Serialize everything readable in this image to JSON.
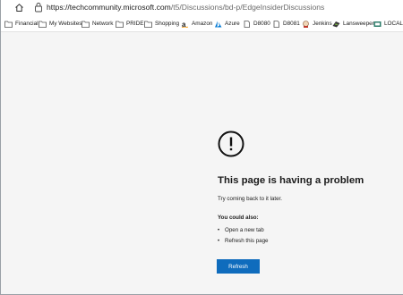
{
  "address_bar": {
    "url_host": "https://techcommunity.microsoft.com",
    "url_path": "/t5/Discussions/bd-p/EdgeInsiderDiscussions"
  },
  "favorites": [
    {
      "label": "Financial",
      "icon": "folder-icon"
    },
    {
      "label": "My Websites",
      "icon": "folder-icon"
    },
    {
      "label": "Network",
      "icon": "folder-icon"
    },
    {
      "label": "PRIDE",
      "icon": "folder-icon"
    },
    {
      "label": "Shopping",
      "icon": "folder-icon"
    },
    {
      "label": "Amazon",
      "icon": "amazon-icon"
    },
    {
      "label": "Azure",
      "icon": "azure-icon"
    },
    {
      "label": "D8080",
      "icon": "page-icon"
    },
    {
      "label": "D8081",
      "icon": "page-icon"
    },
    {
      "label": "Jenkins",
      "icon": "jenkins-icon"
    },
    {
      "label": "Lansweeper",
      "icon": "lansweeper-icon"
    },
    {
      "label": "LOCAL",
      "icon": "local-icon"
    }
  ],
  "error": {
    "icon": "exclamation-circle-icon",
    "title": "This page is having a problem",
    "subtitle": "Try coming back to it later.",
    "also_heading": "You could also:",
    "suggestions": [
      "Open a new tab",
      "Refresh this page"
    ],
    "button_label": "Refresh",
    "button_color": "#0f6cbd"
  }
}
